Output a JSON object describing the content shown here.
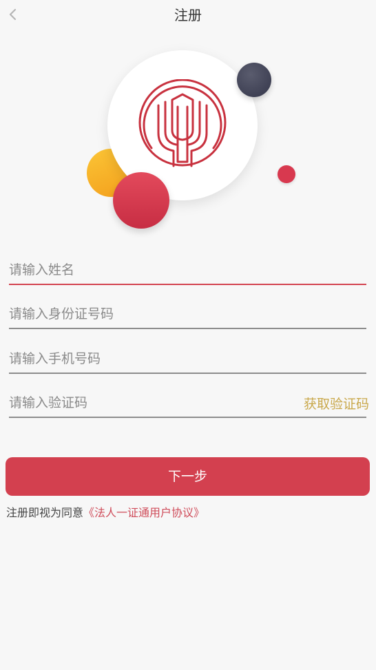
{
  "nav": {
    "title": "注册"
  },
  "form": {
    "name_placeholder": "请输入姓名",
    "id_placeholder": "请输入身份证号码",
    "phone_placeholder": "请输入手机号码",
    "code_placeholder": "请输入验证码",
    "get_code_label": "获取验证码"
  },
  "actions": {
    "next_label": "下一步"
  },
  "agreement": {
    "prefix": "注册即视为同意",
    "link_text": "《法人一证通用户协议》"
  },
  "colors": {
    "primary_red": "#d3404f",
    "gold": "#c9a84b",
    "background": "#f7f7f7"
  },
  "icons": {
    "back": "chevron-left-icon",
    "logo": "tulip-shield-logo"
  }
}
